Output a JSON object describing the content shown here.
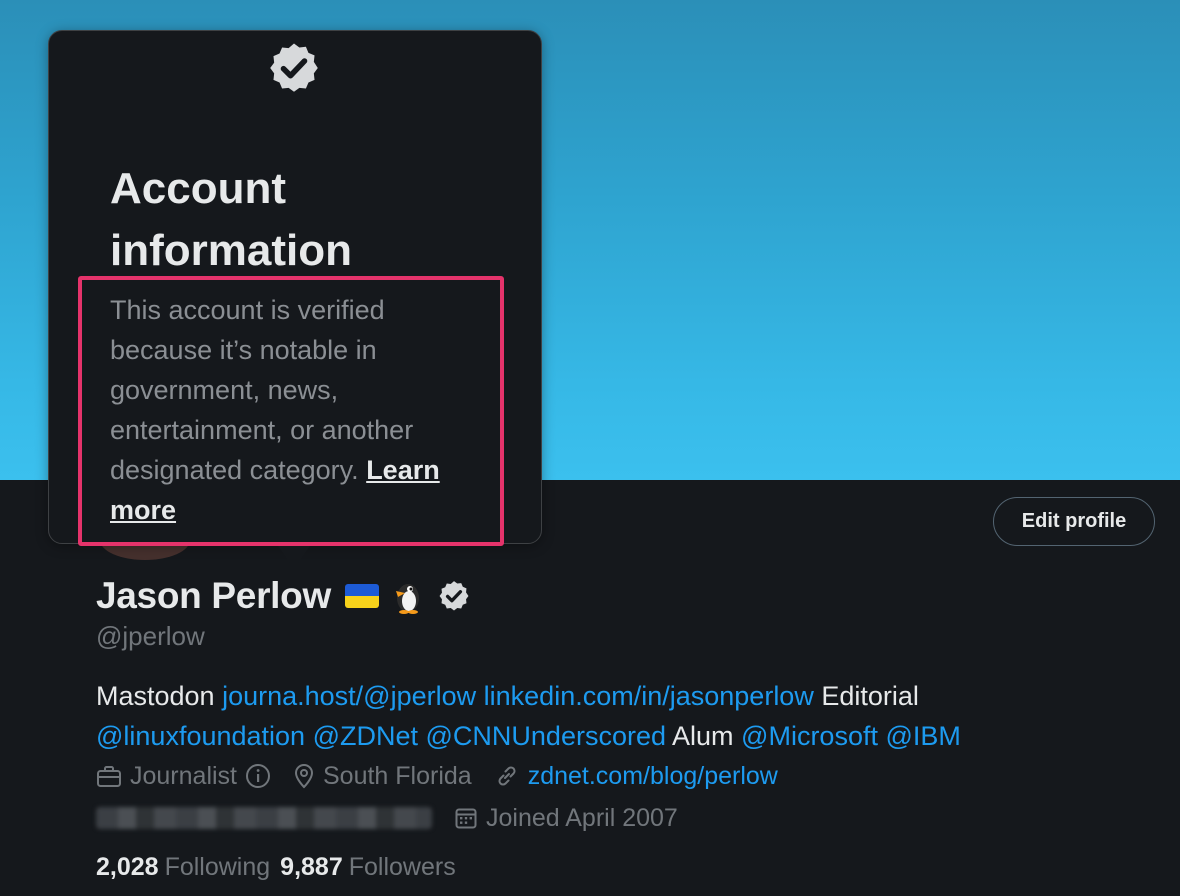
{
  "profile": {
    "name": "Jason Perlow",
    "handle": "@jperlow",
    "edit_button": "Edit profile",
    "bio": {
      "part1": "Mastodon",
      "link1": "journa.host/@jperlow",
      "link2": "linkedin.com/in/jasonperlow",
      "part2": "Editorial",
      "mention1": "@linuxfoundation",
      "mention2": "@ZDNet",
      "mention3": "@CNNUnderscored",
      "part3": "Alum",
      "mention4": "@Microsoft",
      "mention5": "@IBM"
    },
    "meta": {
      "occupation": "Journalist",
      "location": "South Florida",
      "website": "zdnet.com/blog/perlow",
      "joined": "Joined April 2007"
    },
    "stats": {
      "following_count": "2,028",
      "following_label": "Following",
      "followers_count": "9,887",
      "followers_label": "Followers"
    }
  },
  "tooltip": {
    "title": "Account information",
    "body": "This account is verified because it’s notable in government, news, entertainment, or another designated category.",
    "learn_more": "Learn more"
  },
  "colors": {
    "link": "#1d9bf0",
    "highlight": "#e5336b",
    "background": "#15181c",
    "banner": "#36b8e6"
  },
  "icons": [
    "verified-badge-icon",
    "ukraine-flag-icon",
    "penguin-icon",
    "briefcase-icon",
    "info-icon",
    "location-pin-icon",
    "link-icon",
    "calendar-icon"
  ]
}
